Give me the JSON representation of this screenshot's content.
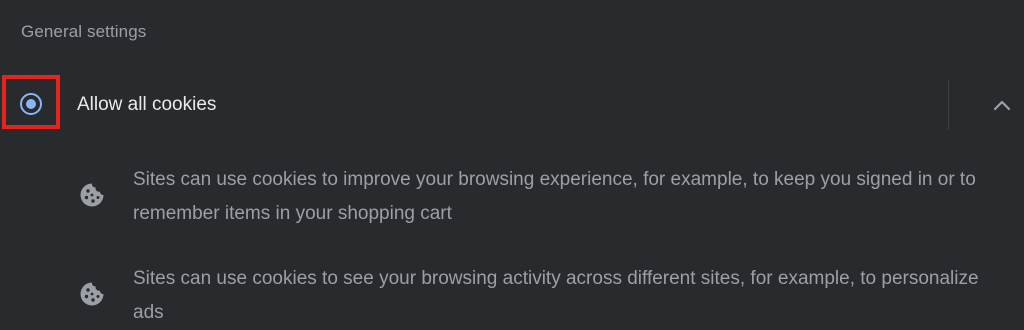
{
  "section": {
    "title": "General settings"
  },
  "option": {
    "label": "Allow all cookies",
    "selected": true,
    "expanded": true,
    "radio_color": "#8ab4f8",
    "highlight_color": "#e8231b"
  },
  "details": [
    {
      "icon": "cookie-icon",
      "text": "Sites can use cookies to improve your browsing experience, for example, to keep you signed in or to remember items in your shopping cart"
    },
    {
      "icon": "cookie-icon",
      "text": "Sites can use cookies to see your browsing activity across different sites, for example, to personalize ads"
    }
  ],
  "colors": {
    "background": "#292a2d",
    "primary_text": "#e8eaed",
    "secondary_text": "#9aa0a6",
    "accent": "#8ab4f8"
  }
}
